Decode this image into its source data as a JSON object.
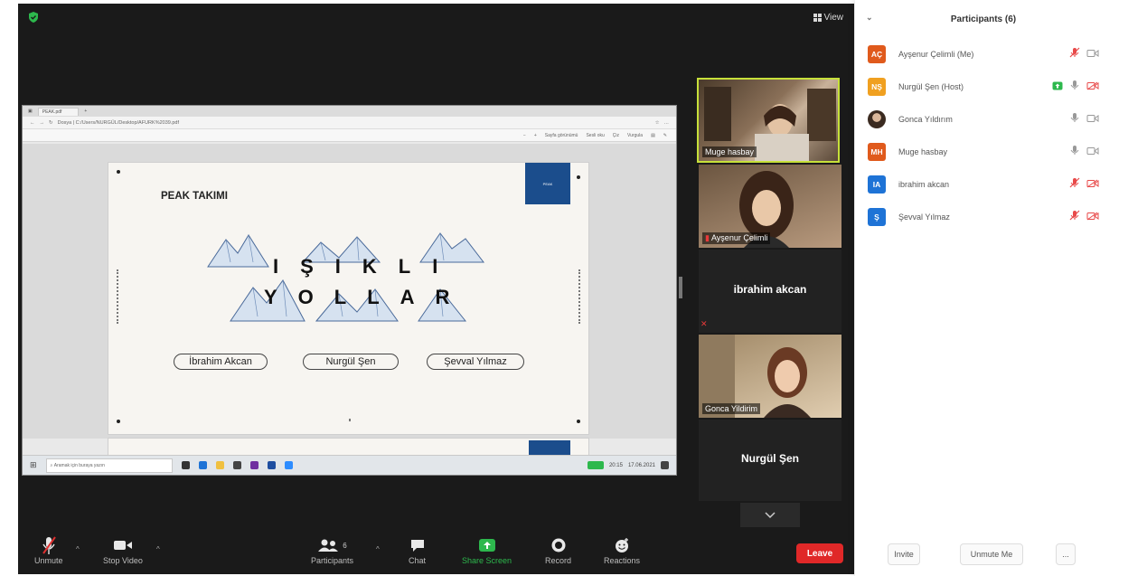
{
  "header": {
    "view_label": "View"
  },
  "browser": {
    "tab_label": "PEAK.pdf",
    "url": "Dosya | C:/Users/NURGÜL/Desktop/AFURK%2039.pdf",
    "tools": [
      "Sayfa görünümü",
      "Sesli oku",
      "Çiz",
      "Vurgula"
    ]
  },
  "slide": {
    "team": "PEAK TAKIMI",
    "title_line1": "IŞIKLI",
    "title_line2": "YOLLAR",
    "names": [
      "İbrahim Akcan",
      "Nurgül Şen",
      "Şevval Yılmaz"
    ]
  },
  "taskbar": {
    "search_placeholder": "Aramak için buraya yazın",
    "time": "20:15",
    "date": "17.06.2021"
  },
  "video_tiles": [
    {
      "name": "Muge hasbay",
      "type": "video",
      "active": true
    },
    {
      "name": "Ayşenur Çelimli",
      "type": "video",
      "muted": true
    },
    {
      "name": "ibrahim akcan",
      "type": "name"
    },
    {
      "name": "Gonca Yildirim",
      "type": "video"
    },
    {
      "name": "Nurgül Şen",
      "type": "name"
    }
  ],
  "toolbar": {
    "unmute": "Unmute",
    "stop_video": "Stop Video",
    "participants": "Participants",
    "participants_count": "6",
    "chat": "Chat",
    "share_screen": "Share Screen",
    "record": "Record",
    "reactions": "Reactions",
    "leave": "Leave"
  },
  "panel": {
    "title": "Participants (6)",
    "participants": [
      {
        "initials": "AÇ",
        "name": "Ayşenur Çelimli (Me)",
        "color": "#e05a1c",
        "mic": "muted",
        "video": "off"
      },
      {
        "initials": "NŞ",
        "name": "Nurgül Şen (Host)",
        "color": "#f0a020",
        "mic": "on",
        "video": "muted",
        "sharing": true
      },
      {
        "initials": "",
        "name": "Gonca Yıldırım",
        "color": "#5a4a3a",
        "mic": "on",
        "video": "off"
      },
      {
        "initials": "MH",
        "name": "Muge hasbay",
        "color": "#e05a1c",
        "mic": "on",
        "video": "off"
      },
      {
        "initials": "IA",
        "name": "ibrahim akcan",
        "color": "#1e73d6",
        "mic": "muted",
        "video": "muted"
      },
      {
        "initials": "Ş",
        "name": "Şevval Yılmaz",
        "color": "#1e73d6",
        "mic": "muted",
        "video": "muted"
      }
    ],
    "invite": "Invite",
    "unmute_me": "Unmute Me",
    "more": "..."
  },
  "colors": {
    "accent_green": "#2db84d",
    "leave_red": "#e02828",
    "zoom_bg": "#1a1a1a",
    "slide_blue": "#1b4d8c"
  }
}
